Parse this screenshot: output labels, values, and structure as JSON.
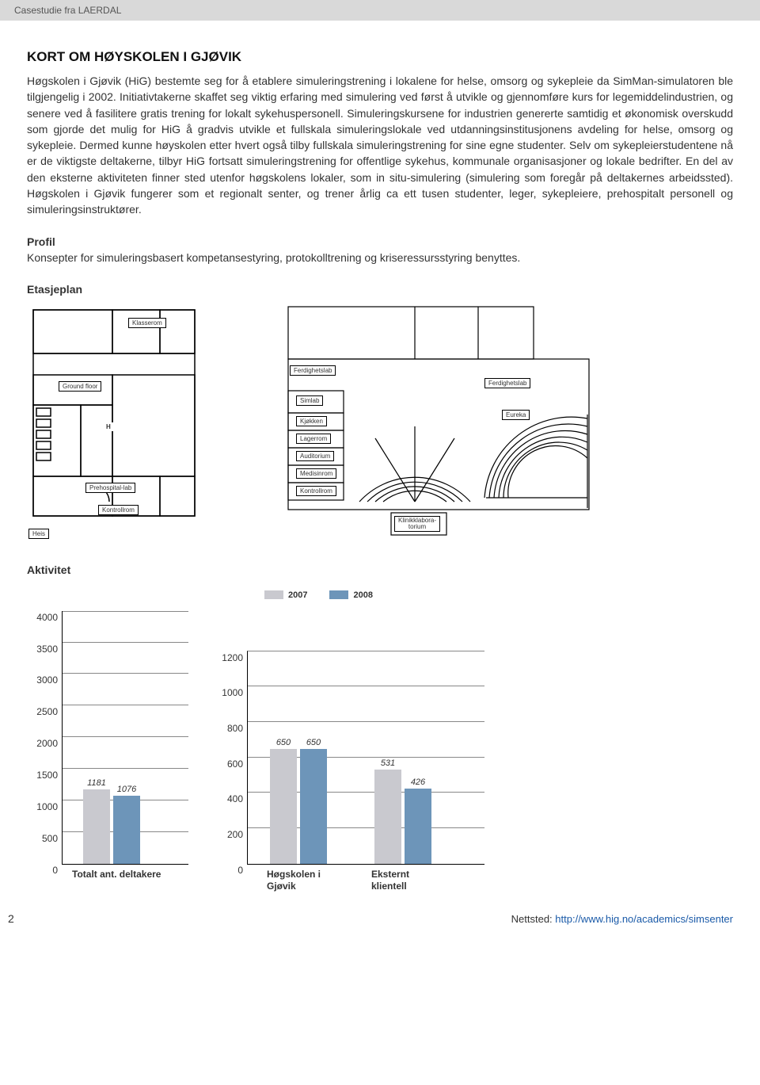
{
  "header": {
    "case_label": "Casestudie fra LAERDAL"
  },
  "section": {
    "title": "KORT OM HØYSKOLEN I GJØVIK",
    "body": "Høgskolen i Gjøvik (HiG) bestemte seg for å etablere simuleringstrening i lokalene for helse, omsorg og sykepleie da SimMan-simulatoren ble tilgjengelig i 2002. Initiativtakerne skaffet seg viktig erfaring med simulering ved først å utvikle og gjennomføre kurs for legemiddelindustrien, og senere ved å fasilitere gratis trening for lokalt sykehuspersonell. Simuleringskursene for industrien genererte samtidig et økonomisk overskudd som gjorde det mulig for HiG å gradvis utvikle et fullskala simuleringslokale ved utdanningsinstitusjonens avdeling for helse, omsorg og sykepleie. Dermed kunne høyskolen etter hvert også tilby fullskala simuleringstrening for sine egne studenter. Selv om sykepleierstudentene nå er de viktigste deltakerne, tilbyr HiG fortsatt simuleringstrening for offentlige sykehus, kommunale organisasjoner og lokale bedrifter. En del av den eksterne aktiviteten finner sted utenfor høgskolens lokaler, som in situ-simulering (simulering som foregår på deltakernes arbeidssted). Høgskolen i Gjøvik fungerer som et regionalt senter, og trener årlig ca ett tusen studenter, leger, sykepleiere, prehospitalt personell og simuleringsinstruktører.",
    "profil_h": "Profil",
    "profil_text": "Konsepter for simuleringsbasert kompetansestyring, protokolltrening og kriseressursstyring benyttes.",
    "etasje_h": "Etasjeplan",
    "aktivitet_h": "Aktivitet"
  },
  "floorplan": {
    "left": {
      "klasserom": "Klasserom",
      "ground": "Ground floor",
      "prehospital": "Prehospital-lab",
      "kontroll": "Kontrollrom",
      "heis": "Heis",
      "h": "H"
    },
    "right": {
      "ferdighetslab": "Ferdighetslab",
      "ferdighetslab2": "Ferdighetslab",
      "simlab": "Simlab",
      "kjokken": "Kjøkken",
      "lagerrom": "Lagerrom",
      "auditorium": "Auditorium",
      "medisinrom": "Medisinrom",
      "kontrollrom": "Kontrollrom",
      "eureka": "Eureka",
      "klinikklab": "Klinikklaboratorium"
    }
  },
  "legend": {
    "y2007": "2007",
    "y2008": "2008"
  },
  "chart_data": [
    {
      "type": "bar",
      "title": "",
      "categories": [
        "Totalt ant. deltakere"
      ],
      "series": [
        {
          "name": "2007",
          "values": [
            1181
          ]
        },
        {
          "name": "2008",
          "values": [
            1076
          ]
        }
      ],
      "ylim": [
        0,
        4000
      ],
      "yticks": [
        0,
        500,
        1000,
        1500,
        2000,
        2500,
        3000,
        3500,
        4000
      ],
      "xlabel": "",
      "ylabel": ""
    },
    {
      "type": "bar",
      "title": "",
      "categories": [
        "Høgskolen i Gjøvik",
        "Eksternt klientell"
      ],
      "series": [
        {
          "name": "2007",
          "values": [
            650,
            531
          ]
        },
        {
          "name": "2008",
          "values": [
            650,
            426
          ]
        }
      ],
      "ylim": [
        0,
        1200
      ],
      "yticks": [
        0,
        200,
        400,
        600,
        800,
        1000,
        1200
      ],
      "xlabel": "",
      "ylabel": ""
    }
  ],
  "colors": {
    "c2007": "#c9c9cf",
    "c2008": "#6d95b9"
  },
  "footer": {
    "page_num": "2",
    "nettsted_label": "Nettsted: ",
    "nettsted_url": "http://www.hig.no/academics/simsenter"
  }
}
